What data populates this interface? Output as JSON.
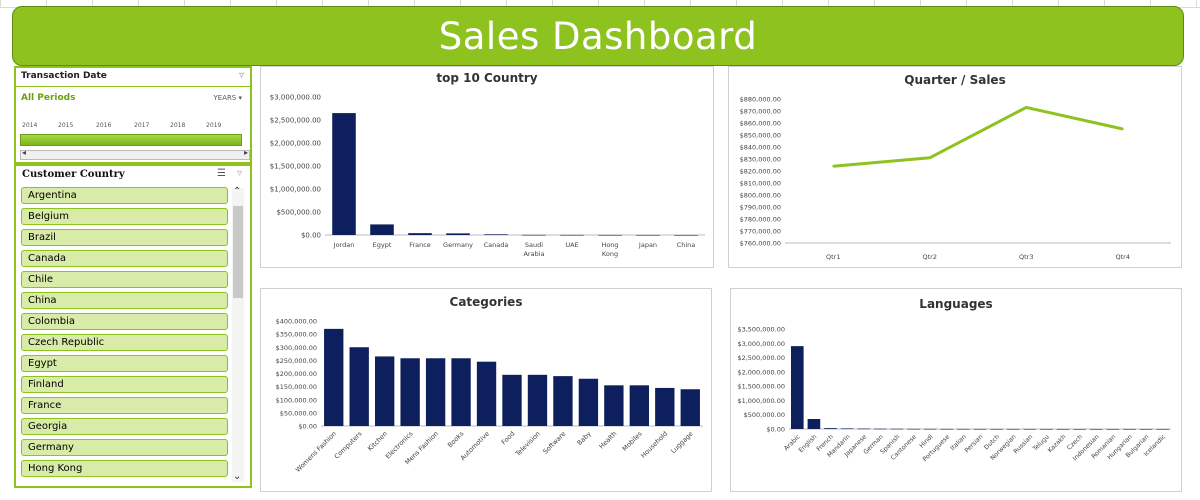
{
  "dashboard": {
    "title": "Sales Dashboard"
  },
  "timeline": {
    "title": "Transaction Date",
    "period_label": "All Periods",
    "level": "YEARS",
    "years": [
      "2014",
      "2015",
      "2016",
      "2017",
      "2018",
      "2019"
    ]
  },
  "country_slicer": {
    "title": "Customer Country",
    "items": [
      "Argentina",
      "Belgium",
      "Brazil",
      "Canada",
      "Chile",
      "China",
      "Colombia",
      "Czech Republic",
      "Egypt",
      "Finland",
      "France",
      "Georgia",
      "Germany",
      "Hong Kong"
    ]
  },
  "colors": {
    "accent": "#8dc21f",
    "bar": "#0d1f5c",
    "slicer_item": "#d8eba8"
  },
  "chart_data": [
    {
      "type": "bar",
      "title": "top 10 Country",
      "categories": [
        "Jordan",
        "Egypt",
        "France",
        "Germany",
        "Canada",
        "Saudi Arabia",
        "UAE",
        "Hong Kong",
        "Japan",
        "China"
      ],
      "values": [
        2650000,
        230000,
        40000,
        35000,
        15000,
        3000,
        2000,
        1500,
        1000,
        800
      ],
      "ylim": [
        0,
        3000000
      ],
      "yticks": [
        "$0.00",
        "$500,000.00",
        "$1,000,000.00",
        "$1,500,000.00",
        "$2,000,000.00",
        "$2,500,000.00",
        "$3,000,000.00"
      ]
    },
    {
      "type": "line",
      "title": "Quarter / Sales",
      "categories": [
        "Qtr1",
        "Qtr2",
        "Qtr3",
        "Qtr4"
      ],
      "values": [
        824000,
        831000,
        873000,
        855000
      ],
      "ylim": [
        760000,
        880000
      ],
      "yticks": [
        "$760,000.00",
        "$770,000.00",
        "$780,000.00",
        "$790,000.00",
        "$800,000.00",
        "$810,000.00",
        "$820,000.00",
        "$830,000.00",
        "$840,000.00",
        "$850,000.00",
        "$860,000.00",
        "$870,000.00",
        "$880,000.00"
      ]
    },
    {
      "type": "bar",
      "title": "Categories",
      "categories": [
        "Womens Fashion",
        "Computers",
        "Kitchen",
        "Electronics",
        "Mens Fashion",
        "Books",
        "Automotive",
        "Food",
        "Television",
        "Software",
        "Baby",
        "Health",
        "Mobiles",
        "Household",
        "Luggage"
      ],
      "values": [
        370000,
        300000,
        265000,
        258000,
        258000,
        258000,
        245000,
        195000,
        195000,
        190000,
        180000,
        155000,
        155000,
        145000,
        140000
      ],
      "ylim": [
        0,
        400000
      ],
      "yticks": [
        "$0.00",
        "$50,000.00",
        "$100,000.00",
        "$150,000.00",
        "$200,000.00",
        "$250,000.00",
        "$300,000.00",
        "$350,000.00",
        "$400,000.00"
      ]
    },
    {
      "type": "bar",
      "title": "Languages",
      "categories": [
        "Arabic",
        "English",
        "French",
        "Mandarin",
        "Japanese",
        "German",
        "Spanish",
        "Cantonese",
        "Hindi",
        "Portuguese",
        "Italian",
        "Persian",
        "Dutch",
        "Norwegian",
        "Russian",
        "Telugu",
        "Kazakh",
        "Czech",
        "Indonesian",
        "Romanian",
        "Hungarian",
        "Bulgarian",
        "Icelandic"
      ],
      "values": [
        2900000,
        350000,
        30000,
        20000,
        15000,
        10000,
        8000,
        5000,
        4000,
        3000,
        3000,
        2500,
        2000,
        2000,
        1500,
        1500,
        1000,
        1000,
        1000,
        800,
        800,
        600,
        500
      ],
      "ylim": [
        0,
        3500000
      ],
      "yticks": [
        "$0.00",
        "$500,000.00",
        "$1,000,000.00",
        "$1,500,000.00",
        "$2,000,000.00",
        "$2,500,000.00",
        "$3,000,000.00",
        "$3,500,000.00"
      ]
    }
  ]
}
